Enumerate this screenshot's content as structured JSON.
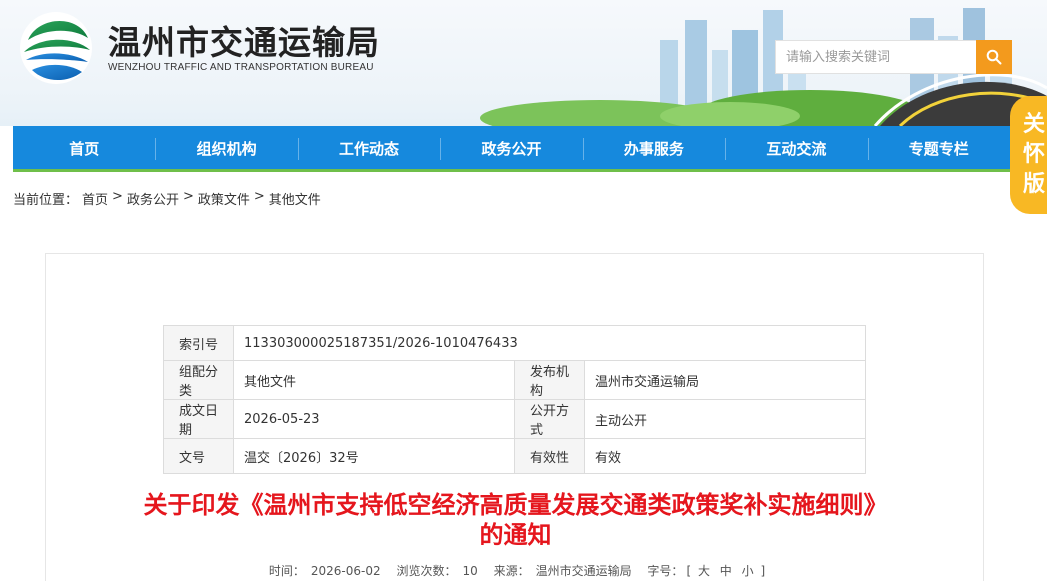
{
  "header": {
    "title": "温州市交通运输局",
    "subtitle": "WENZHOU TRAFFIC AND TRANSPORTATION BUREAU",
    "search_placeholder": "请输入搜索关键词"
  },
  "nav": [
    "首页",
    "组织机构",
    "工作动态",
    "政务公开",
    "办事服务",
    "互动交流",
    "专题专栏"
  ],
  "care_badge": [
    "关",
    "怀",
    "版"
  ],
  "breadcrumb": {
    "prefix": "当前位置：",
    "items": [
      "首页",
      "政务公开",
      "政策文件",
      "其他文件"
    ],
    "separator": ">"
  },
  "meta": {
    "index_label": "索引号",
    "index_value": "113303000025187351/2026-1010476433",
    "category_label": "组配分类",
    "category_value": "其他文件",
    "publisher_label": "发布机构",
    "publisher_value": "温州市交通运输局",
    "date_label": "成文日期",
    "date_value": "2026-05-23",
    "public_label": "公开方式",
    "public_value": "主动公开",
    "doc_no_label": "文号",
    "doc_no_value": "温交〔2026〕32号",
    "validity_label": "有效性",
    "validity_value": "有效"
  },
  "document": {
    "title_line1": "关于印发《温州市支持低空经济高质量发展交通类政策奖补实施细则》",
    "title_line2": "的通知",
    "time_label": "时间：",
    "time_value": "2026-06-02",
    "views_label": "浏览次数：",
    "views_value": "10",
    "source_label": "来源：",
    "source_value": "温州市交通运输局",
    "font_size_label": "字号：",
    "size_large": "大",
    "size_medium": "中",
    "size_small": "小"
  },
  "colors": {
    "nav": "#1689dd",
    "accent": "#f39a1d",
    "title": "#e5161d",
    "badge": "#f8b824"
  }
}
